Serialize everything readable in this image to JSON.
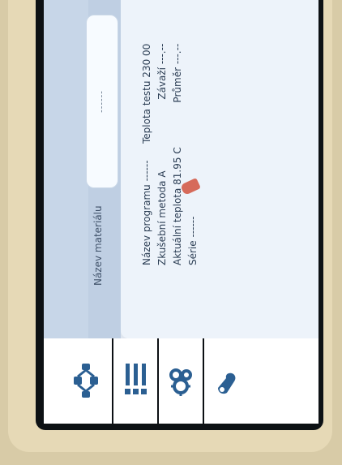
{
  "material": {
    "label": "Název materiálu",
    "value": "------"
  },
  "program": {
    "name_line": "Název programu  ------",
    "method_line": "Zkušební metoda  A",
    "temp_line": "Aktuální teplota  81.95 C",
    "series_line": "Série  ------"
  },
  "right_info": {
    "test_temp_line": "Teplota testu  230 00",
    "weight_line": "Závaží  ---.--",
    "diameter_line": "Průměr  ---.--"
  },
  "colors": {
    "accent": "#2f83c6",
    "menu_icon": "#2b5f92",
    "indicator": "#d66a5a"
  },
  "icons": {
    "logo": "brand-logo-icon",
    "keyboard": "keyboard-icon",
    "network": "network-icon",
    "list": "list-icon",
    "settings": "gears-icon",
    "wrench": "wrench-icon"
  }
}
